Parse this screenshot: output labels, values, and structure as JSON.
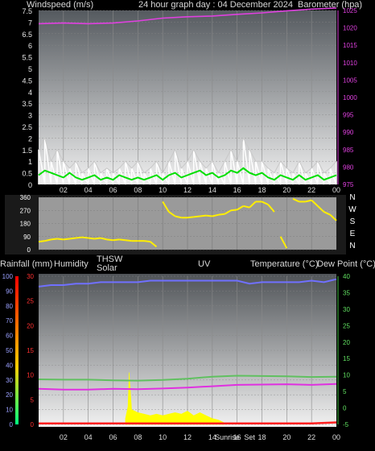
{
  "header": {
    "left": "Windspeed (m/s)",
    "center": "24 hour graph day : 04 December 2024",
    "right": "Barometer (hpa)"
  },
  "bottom_header": {
    "rainfall": "Rainfall (mm)",
    "humidity": "Humidity",
    "thsw": "THSW",
    "solar": "Solar",
    "uv": "UV",
    "temperature": "Temperature (°C)",
    "dewpoint": "Dew Point (°C)"
  },
  "time_labels": [
    "02",
    "04",
    "06",
    "08",
    "10",
    "12",
    "14",
    "16",
    "18",
    "20",
    "22",
    "00"
  ],
  "compass_labels": [
    "N",
    "W",
    "S",
    "E",
    "N"
  ],
  "sun_labels": {
    "rise": "Sunrise",
    "set": "Set"
  },
  "colors": {
    "wind": "#ffffff",
    "gust": "#c8c8c8",
    "avg_wind": "#00e000",
    "barometer": "#e040e0",
    "direction": "#ffee00",
    "humidity": "#7070ff",
    "temperature": "#e030e0",
    "dewpoint": "#60c060",
    "solar": "#ffff00",
    "rain": "#ff2020",
    "uv_axis": "#3030ff"
  },
  "chart_data": [
    {
      "type": "line",
      "title": "24 hour graph day : 04 December 2024",
      "ylabel": "Windspeed (m/s)",
      "y2label": "Barometer (hpa)",
      "ylim": [
        0,
        7.5
      ],
      "yticks": [
        "0",
        "0.5",
        "1",
        "1.5",
        "2",
        "2.5",
        "3",
        "3.5",
        "4",
        "4.5",
        "5",
        "5.5",
        "6",
        "6.5",
        "7",
        "7.5"
      ],
      "y2lim": [
        975,
        1025
      ],
      "y2ticks": [
        "975",
        "980",
        "985",
        "990",
        "995",
        "1000",
        "1005",
        "1010",
        "1015",
        "1020",
        "1025"
      ],
      "xlim": [
        0,
        24
      ],
      "series": [
        {
          "key": "barometer",
          "axis": "y2",
          "x": [
            0,
            2,
            4,
            6,
            8,
            10,
            12,
            14,
            16,
            18,
            20,
            22,
            24
          ],
          "values": [
            1021.2,
            1021.4,
            1021.2,
            1021.4,
            1022,
            1022.8,
            1023.2,
            1023.4,
            1023.9,
            1024.3,
            1024.9,
            1025.4,
            1025.7
          ]
        },
        {
          "key": "wind",
          "axis": "y",
          "x": [
            0,
            0.5,
            1,
            1.5,
            2,
            2.5,
            3,
            3.5,
            4,
            4.5,
            5,
            5.5,
            6,
            6.5,
            7,
            7.5,
            8,
            8.5,
            9,
            9.5,
            10,
            10.5,
            11,
            11.5,
            12,
            12.5,
            13,
            13.5,
            14,
            14.5,
            15,
            15.5,
            16,
            16.5,
            17,
            17.5,
            18,
            18.5,
            19,
            19.5,
            20,
            20.5,
            21,
            21.5,
            22,
            22.5,
            23,
            23.5,
            24
          ],
          "values": [
            1.5,
            2.0,
            1.0,
            1.5,
            1.0,
            0.7,
            1.0,
            0.5,
            0.7,
            1.0,
            0.5,
            0.7,
            0.5,
            0.7,
            1.0,
            0.7,
            1.0,
            0.5,
            0.7,
            1.0,
            0.5,
            1.0,
            1.5,
            0.7,
            1.0,
            1.5,
            1.0,
            0.7,
            1.0,
            0.5,
            1.0,
            1.5,
            1.0,
            2.0,
            1.5,
            1.0,
            1.0,
            0.7,
            0.5,
            1.0,
            0.7,
            0.5,
            1.0,
            0.5,
            0.7,
            1.0,
            0.5,
            0.7,
            1.0
          ]
        },
        {
          "key": "avg_wind",
          "axis": "y",
          "x": [
            0,
            0.5,
            1,
            1.5,
            2,
            2.5,
            3,
            3.5,
            4,
            4.5,
            5,
            5.5,
            6,
            6.5,
            7,
            7.5,
            8,
            8.5,
            9,
            9.5,
            10,
            10.5,
            11,
            11.5,
            12,
            12.5,
            13,
            13.5,
            14,
            14.5,
            15,
            15.5,
            16,
            16.5,
            17,
            17.5,
            18,
            18.5,
            19,
            19.5,
            20,
            20.5,
            21,
            21.5,
            22,
            22.5,
            23,
            23.5,
            24
          ],
          "values": [
            0.4,
            0.6,
            0.5,
            0.4,
            0.3,
            0.5,
            0.3,
            0.2,
            0.3,
            0.4,
            0.2,
            0.3,
            0.2,
            0.4,
            0.3,
            0.2,
            0.3,
            0.2,
            0.3,
            0.4,
            0.2,
            0.4,
            0.5,
            0.3,
            0.4,
            0.5,
            0.6,
            0.4,
            0.5,
            0.3,
            0.4,
            0.6,
            0.5,
            0.7,
            0.5,
            0.4,
            0.5,
            0.3,
            0.2,
            0.4,
            0.3,
            0.2,
            0.4,
            0.2,
            0.3,
            0.4,
            0.2,
            0.3,
            0.4
          ]
        }
      ]
    },
    {
      "type": "scatter",
      "ylabel": "Wind direction",
      "ylim": [
        0,
        360
      ],
      "yticks": [
        "0",
        "90",
        "180",
        "270",
        "360"
      ],
      "xlim": [
        0,
        24
      ],
      "series": [
        {
          "key": "direction",
          "x": [
            0,
            0.5,
            1,
            1.5,
            2,
            2.5,
            3,
            3.5,
            4,
            4.5,
            5,
            5.5,
            6,
            6.5,
            7,
            7.5,
            8,
            8.5,
            9,
            9.5,
            10,
            10.5,
            11,
            11.5,
            12,
            12.5,
            13,
            13.5,
            14,
            14.5,
            15,
            15.5,
            16,
            16.5,
            17,
            17.5,
            18,
            18.5,
            19,
            19.5,
            20,
            20.5,
            21,
            21.5,
            22,
            22.5,
            23,
            23.5,
            24
          ],
          "values": [
            55,
            60,
            70,
            75,
            70,
            75,
            80,
            85,
            80,
            75,
            80,
            70,
            65,
            70,
            65,
            60,
            60,
            60,
            55,
            20,
            330,
            260,
            230,
            220,
            220,
            225,
            230,
            235,
            230,
            240,
            245,
            270,
            275,
            300,
            290,
            330,
            330,
            310,
            260,
            90,
            10,
            350,
            330,
            330,
            340,
            300,
            260,
            240,
            200
          ]
        }
      ]
    },
    {
      "type": "line",
      "ylabel": "Rainfall (mm)",
      "ylim": [
        0,
        30
      ],
      "yticks": [
        "0",
        "5",
        "10",
        "15",
        "20",
        "25",
        "30"
      ],
      "y_humidity_lim": [
        0,
        100
      ],
      "y_humidity_ticks": [
        "0",
        "10",
        "20",
        "30",
        "40",
        "50",
        "60",
        "70",
        "80",
        "90",
        "100"
      ],
      "y2label": "Temperature (°C)",
      "y2lim": [
        -5,
        40
      ],
      "y2ticks": [
        "-5",
        "0",
        "5",
        "10",
        "15",
        "20",
        "25",
        "30",
        "35",
        "40"
      ],
      "xlim": [
        0,
        24
      ],
      "series": [
        {
          "key": "humidity",
          "axis": "humidity",
          "x": [
            0,
            1,
            2,
            3,
            4,
            5,
            6,
            7,
            8,
            9,
            10,
            11,
            12,
            13,
            14,
            15,
            16,
            17,
            18,
            19,
            20,
            21,
            22,
            23,
            24
          ],
          "values": [
            93,
            94,
            94,
            95,
            95,
            96,
            96,
            96,
            96,
            97,
            97,
            97,
            97,
            97,
            97,
            97,
            97,
            95,
            96,
            96,
            96,
            96,
            97,
            96,
            98
          ]
        },
        {
          "key": "temperature",
          "axis": "y2",
          "x": [
            0,
            2,
            4,
            6,
            8,
            10,
            12,
            14,
            16,
            18,
            20,
            22,
            24
          ],
          "values": [
            5.8,
            5.6,
            5.6,
            5.8,
            5.7,
            5.9,
            6.2,
            6.6,
            7.0,
            7.1,
            7.2,
            7.0,
            7.3
          ]
        },
        {
          "key": "dewpoint",
          "axis": "y2",
          "x": [
            0,
            2,
            4,
            6,
            8,
            10,
            12,
            14,
            16,
            18,
            20,
            22,
            24
          ],
          "values": [
            8.7,
            8.6,
            8.6,
            8.4,
            8.3,
            8.5,
            8.9,
            9.5,
            9.8,
            9.7,
            9.6,
            9.4,
            9.5
          ]
        },
        {
          "key": "solar",
          "axis": "humidity",
          "x": [
            7.0,
            7.2,
            7.3,
            7.4,
            7.5,
            8,
            8.5,
            9,
            9.5,
            10,
            10.5,
            11,
            11.5,
            12,
            12.5,
            13,
            13.5,
            14,
            14.5,
            15
          ],
          "values": [
            4,
            12,
            35,
            22,
            10,
            8,
            7,
            6,
            7,
            6,
            7,
            8,
            7,
            9,
            6,
            8,
            6,
            4,
            3,
            1
          ]
        },
        {
          "key": "rain",
          "axis": "y",
          "x": [
            0,
            2,
            4,
            6,
            8,
            10,
            12,
            14,
            16,
            18,
            20,
            22,
            24
          ],
          "values": [
            0.2,
            0.2,
            0.2,
            0.2,
            0.2,
            0.2,
            0.2,
            0.2,
            0.2,
            0.2,
            0.2,
            0.2,
            0.4
          ]
        }
      ]
    }
  ]
}
